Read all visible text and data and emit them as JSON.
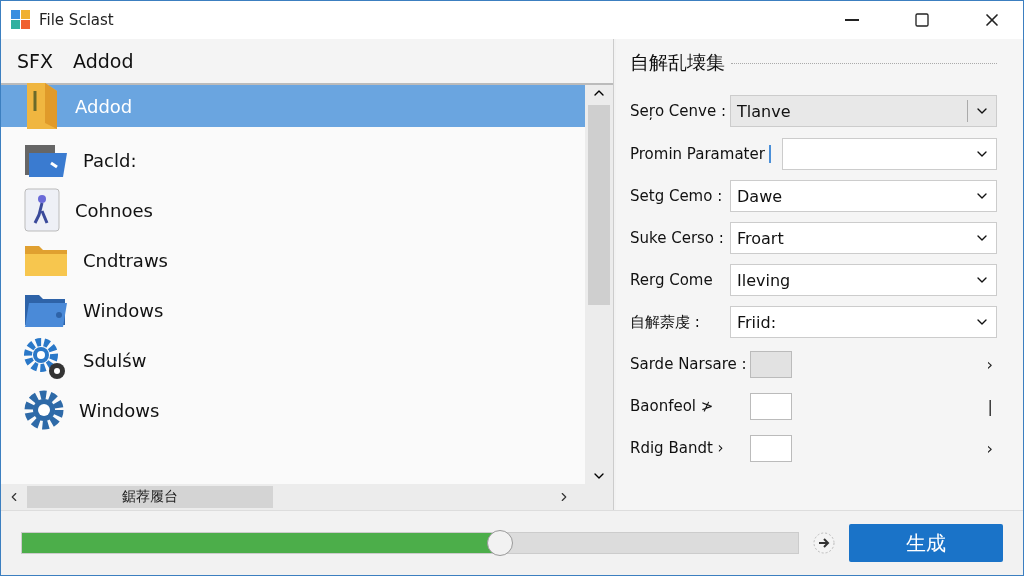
{
  "window": {
    "title": "File Sclast"
  },
  "left_panel": {
    "header": [
      "SFX",
      "Addod"
    ],
    "items": [
      {
        "label": "Addod",
        "kind": "zip",
        "selected": true
      },
      {
        "label": "Pacld:",
        "kind": "toolfolder",
        "selected": false
      },
      {
        "label": "Cohnoes",
        "kind": "figure",
        "selected": false
      },
      {
        "label": "Cndtraws",
        "kind": "folder",
        "selected": false
      },
      {
        "label": "Windows",
        "kind": "bluefolder",
        "selected": false
      },
      {
        "label": "Sdulśw",
        "kind": "gears",
        "selected": false
      },
      {
        "label": "Windows",
        "kind": "gear",
        "selected": false
      }
    ],
    "hscroll_label": "鋸荐履台"
  },
  "right_panel": {
    "title": "自解乱壊集",
    "rows": [
      {
        "kind": "combo",
        "label": "Seŗo Cenve :",
        "value": "Tlanve"
      },
      {
        "kind": "dropdown",
        "label": "Promin Paramater",
        "cursor": true
      },
      {
        "kind": "dropdown",
        "label": "Setg Cemo :",
        "value": "Dawe"
      },
      {
        "kind": "dropdown",
        "label": "Suke Cerso :",
        "value": "Froart"
      },
      {
        "kind": "dropdown",
        "label": "Rerg Come",
        "value": "Ileving"
      },
      {
        "kind": "dropdown",
        "label": "自解萘虔 :",
        "value": "Friid:"
      },
      {
        "kind": "box",
        "label": "Sarde Narsare :",
        "filled": true,
        "end": "›"
      },
      {
        "kind": "box",
        "label": "Baonfeol ≯",
        "filled": false,
        "end": "|"
      },
      {
        "kind": "box",
        "label": "Rdig Bandt ›",
        "filled": false,
        "end": "›"
      }
    ]
  },
  "footer": {
    "progress": {
      "level": 0.615
    },
    "button": "生成"
  }
}
